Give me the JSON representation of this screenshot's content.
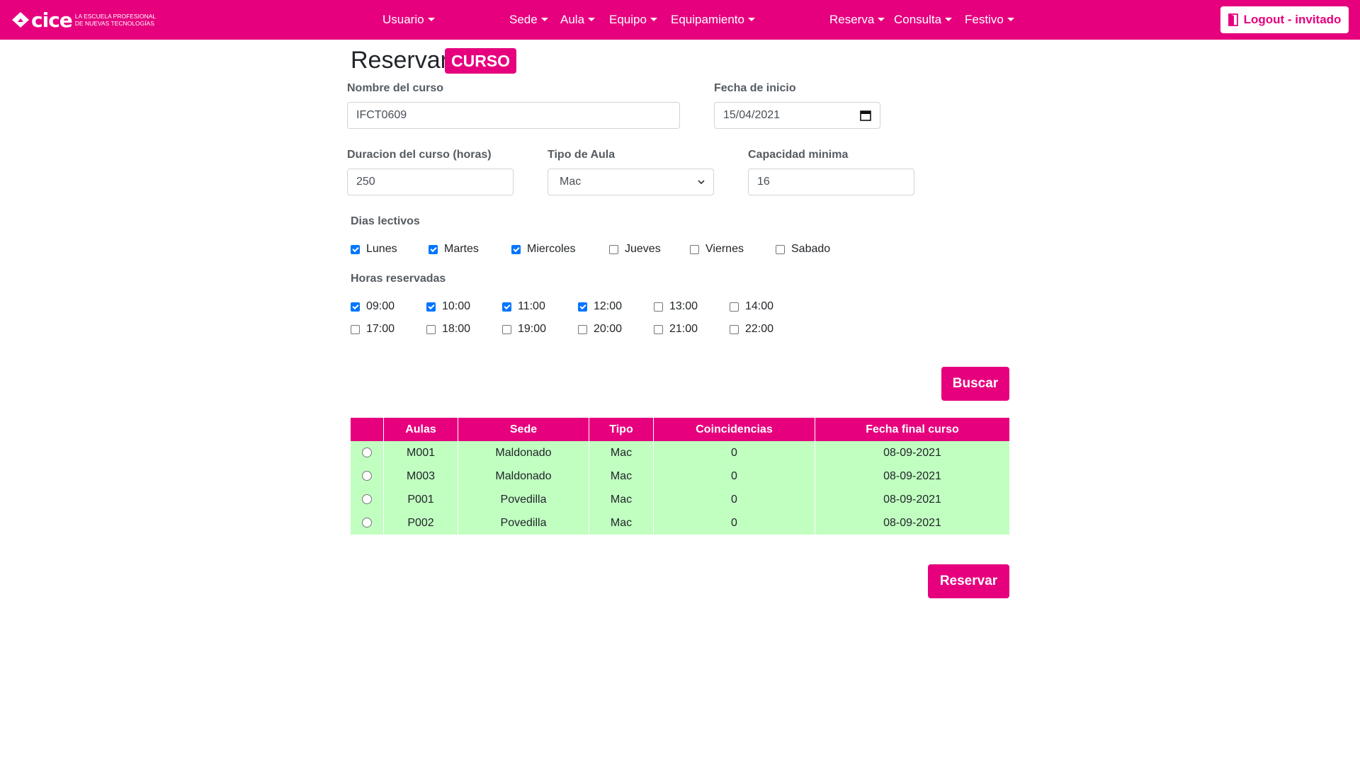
{
  "navbar": {
    "logo_text": "cice",
    "logo_tagline_1": "LA ESCUELA PROFESIONAL",
    "logo_tagline_2": "DE NUEVAS TECNOLOGÍAS",
    "menu": [
      "Usuario",
      "Sede",
      "Aula",
      "Equipo",
      "Equipamiento",
      "Reserva",
      "Consulta",
      "Festivo"
    ],
    "logout_label": "Logout - invitado",
    "accent_color": "#e6007e"
  },
  "page": {
    "title": "Reservar",
    "badge": "CURSO"
  },
  "form": {
    "nombre_label": "Nombre del curso",
    "nombre_value": "IFCT0609",
    "fecha_label": "Fecha de inicio",
    "fecha_value": "15/04/2021",
    "duracion_label": "Duracion del curso (horas)",
    "duracion_value": "250",
    "tipo_label": "Tipo de Aula",
    "tipo_value": "Mac",
    "capacidad_label": "Capacidad minima",
    "capacidad_value": "16"
  },
  "dias": {
    "label": "Dias lectivos",
    "items": [
      {
        "label": "Lunes",
        "checked": true
      },
      {
        "label": "Martes",
        "checked": true
      },
      {
        "label": "Miercoles",
        "checked": true
      },
      {
        "label": "Jueves",
        "checked": false
      },
      {
        "label": "Viernes",
        "checked": false
      },
      {
        "label": "Sabado",
        "checked": false
      }
    ]
  },
  "horas": {
    "label": "Horas reservadas",
    "items": [
      {
        "label": "09:00",
        "checked": true
      },
      {
        "label": "10:00",
        "checked": true
      },
      {
        "label": "11:00",
        "checked": true
      },
      {
        "label": "12:00",
        "checked": true
      },
      {
        "label": "13:00",
        "checked": false
      },
      {
        "label": "14:00",
        "checked": false
      },
      {
        "label": "17:00",
        "checked": false
      },
      {
        "label": "18:00",
        "checked": false
      },
      {
        "label": "19:00",
        "checked": false
      },
      {
        "label": "20:00",
        "checked": false
      },
      {
        "label": "21:00",
        "checked": false
      },
      {
        "label": "22:00",
        "checked": false
      }
    ]
  },
  "buttons": {
    "buscar": "Buscar",
    "reservar": "Reservar"
  },
  "table": {
    "headers": [
      "",
      "Aulas",
      "Sede",
      "Tipo",
      "Coincidencias",
      "Fecha final curso"
    ],
    "rows": [
      {
        "aula": "M001",
        "sede": "Maldonado",
        "tipo": "Mac",
        "coincidencias": "0",
        "fecha": "08-09-2021"
      },
      {
        "aula": "M003",
        "sede": "Maldonado",
        "tipo": "Mac",
        "coincidencias": "0",
        "fecha": "08-09-2021"
      },
      {
        "aula": "P001",
        "sede": "Povedilla",
        "tipo": "Mac",
        "coincidencias": "0",
        "fecha": "08-09-2021"
      },
      {
        "aula": "P002",
        "sede": "Povedilla",
        "tipo": "Mac",
        "coincidencias": "0",
        "fecha": "08-09-2021"
      }
    ],
    "row_color": "#c1ffc1"
  }
}
